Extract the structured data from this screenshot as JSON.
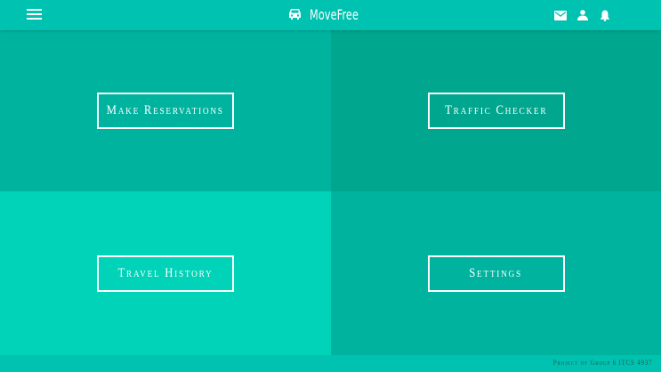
{
  "header": {
    "brand": "MoveFree",
    "icons": [
      "menu-icon",
      "car-icon",
      "mail-icon",
      "person-icon",
      "bell-icon"
    ]
  },
  "tiles": [
    {
      "label": "Make Reservations",
      "color": "#00b39f"
    },
    {
      "label": "Traffic Checker",
      "color": "#00a68d"
    },
    {
      "label": "Travel History",
      "color": "#00d3b7"
    },
    {
      "label": "Settings",
      "color": "#00b39f"
    }
  ],
  "footer": {
    "credit": "Project of Group 6 ITCS 4937"
  },
  "colors": {
    "topbar": "#00c2b0",
    "text": "#ffffff"
  }
}
